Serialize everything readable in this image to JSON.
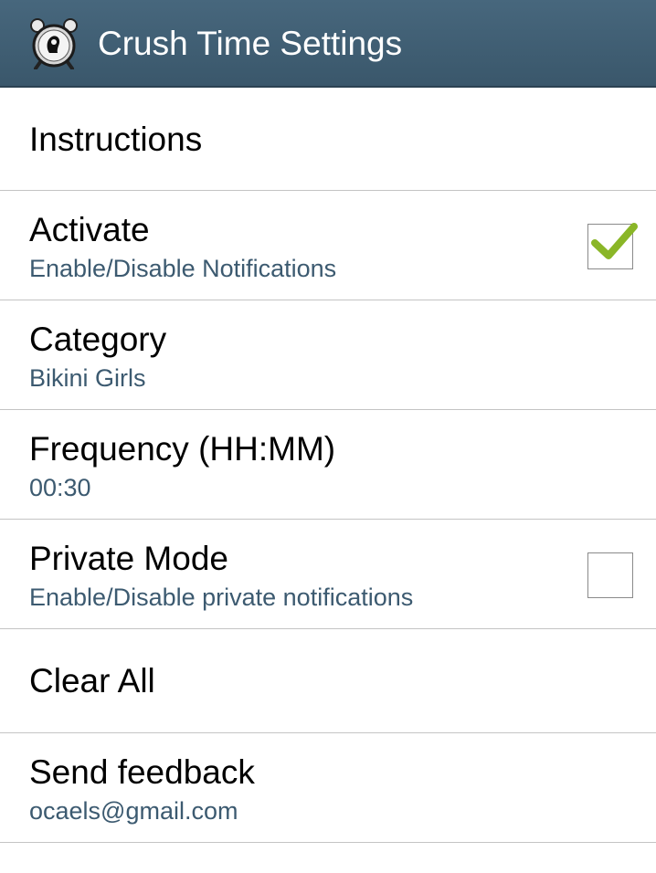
{
  "app": {
    "title": "Crush Time Settings",
    "icon": "alarm-clock-icon"
  },
  "preferences": [
    {
      "title": "Instructions"
    },
    {
      "title": "Activate",
      "summary": "Enable/Disable Notifications",
      "checked": true
    },
    {
      "title": "Category",
      "summary": "Bikini Girls"
    },
    {
      "title": "Frequency (HH:MM)",
      "summary": "00:30"
    },
    {
      "title": "Private Mode",
      "summary": "Enable/Disable private notifications",
      "checked": false
    },
    {
      "title": "Clear All"
    },
    {
      "title": "Send feedback",
      "summary": "ocaels@gmail.com"
    }
  ],
  "colors": {
    "action_bar": "#3f5e73",
    "summary_text": "#3c5a70",
    "check_mark": "#8ab627",
    "divider": "#c4c4c4"
  }
}
